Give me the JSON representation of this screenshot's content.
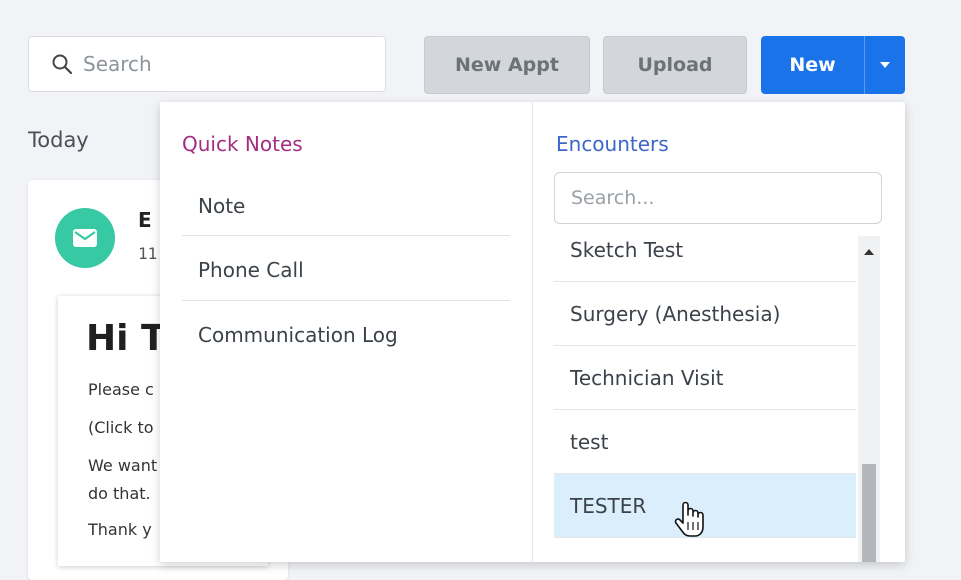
{
  "search": {
    "placeholder": "Search"
  },
  "toolbar": {
    "new_appt_label": "New Appt",
    "upload_label": "Upload",
    "new_label": "New"
  },
  "background": {
    "section_label": "Today",
    "sender_partial": "E",
    "time_partial": "11",
    "email_heading_partial": "Hi T",
    "email_lines": [
      "Please c",
      "(Click to",
      "We want",
      "do that.",
      "Thank y"
    ]
  },
  "dropdown": {
    "quick_notes": {
      "heading": "Quick Notes",
      "items": [
        "Note",
        "Phone Call",
        "Communication Log"
      ]
    },
    "encounters": {
      "heading": "Encounters",
      "search_placeholder": "Search...",
      "items": [
        "Sketch Test",
        "Surgery (Anesthesia)",
        "Technician Visit",
        "test",
        "TESTER"
      ],
      "highlighted_item": "TESTER"
    }
  },
  "colors": {
    "primary_button": "#1a73e8",
    "quick_notes_heading": "#a32d83",
    "encounters_heading": "#3e66c9",
    "mail_icon_bg": "#36c9a3",
    "highlight_row": "#dbeefb"
  },
  "icons": {
    "search": "search-icon",
    "caret": "caret-down-icon",
    "mail": "mail-icon",
    "scroll_up": "scroll-up-arrow-icon",
    "cursor": "hand-pointer-cursor-icon"
  }
}
